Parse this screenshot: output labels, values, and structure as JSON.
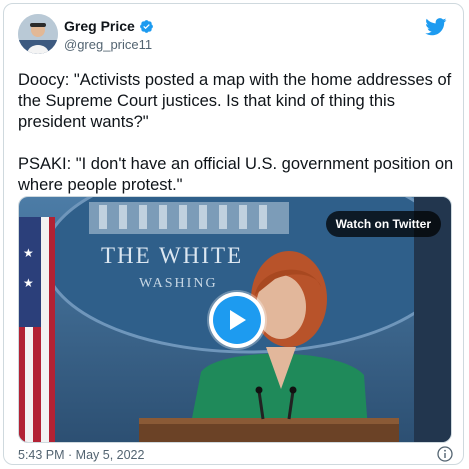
{
  "author": {
    "display_name": "Greg Price",
    "handle": "@greg_price11",
    "verified": true,
    "avatar_icon": "avatar"
  },
  "tweet": {
    "paragraphs": [
      "Doocy: \"Activists posted a map with the home addresses of the Supreme Court justices. Is that kind of thing this president wants?\"",
      "PSAKI: \"I don't have an official U.S. government position on where people protest.\""
    ]
  },
  "media": {
    "watch_label": "Watch on Twitter",
    "backdrop_text_1": "THE WHITE",
    "backdrop_text_2": "WASHING",
    "play_icon": "play-icon"
  },
  "footer": {
    "timestamp": "5:43 PM · May 5, 2022",
    "info_icon": "info-icon"
  },
  "colors": {
    "accent": "#1d9bf0",
    "text": "#0f1419",
    "muted": "#536471",
    "border": "#cfd9de"
  }
}
